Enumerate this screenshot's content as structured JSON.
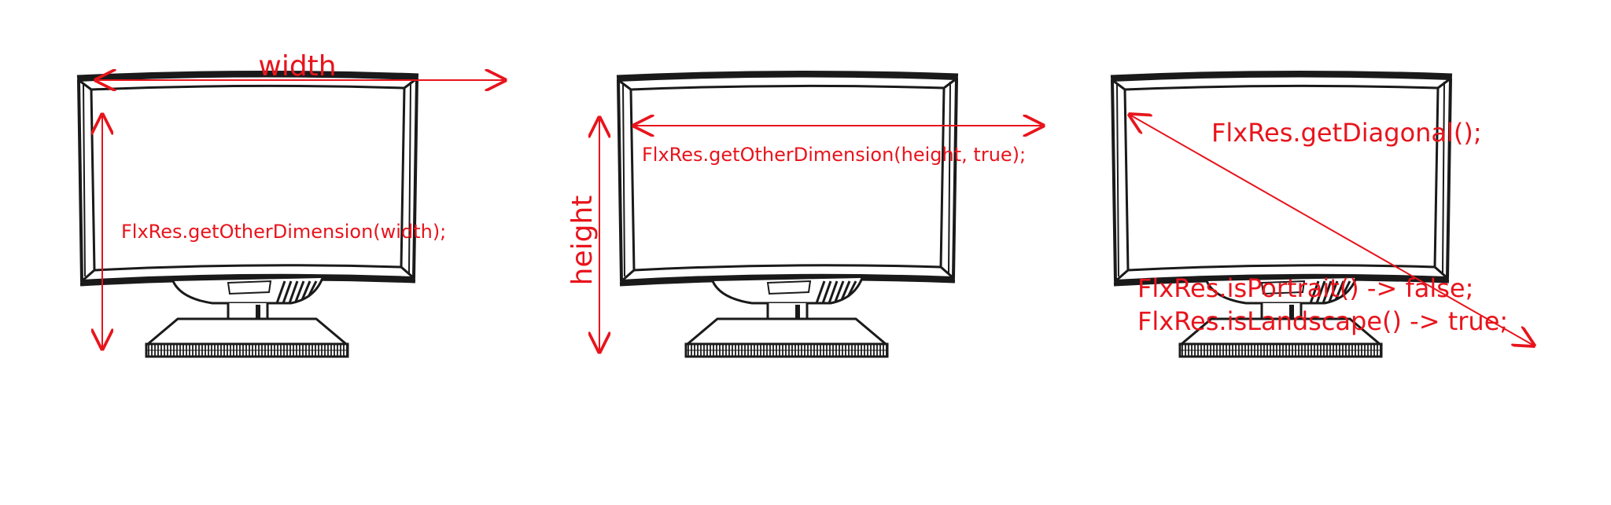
{
  "colors": {
    "annotation": "#e8141c",
    "ink": "#1a1a1a",
    "background": "#ffffff"
  },
  "monitors": [
    {
      "name": "monitor-width",
      "labels": {
        "dimension": "width",
        "code": "FlxRes.getOtherDimension(width);"
      }
    },
    {
      "name": "monitor-height",
      "labels": {
        "dimension": "height",
        "code": "FlxRes.getOtherDimension(height, true);"
      }
    },
    {
      "name": "monitor-diagonal",
      "labels": {
        "code": "FlxRes.getDiagonal();",
        "portrait": "FlxRes.isPortrait() -> false;",
        "landscape": "FlxRes.isLandscape() -> true;"
      }
    }
  ],
  "icons": {
    "monitor": "monitor-icon",
    "arrow": "double-arrow-icon"
  }
}
